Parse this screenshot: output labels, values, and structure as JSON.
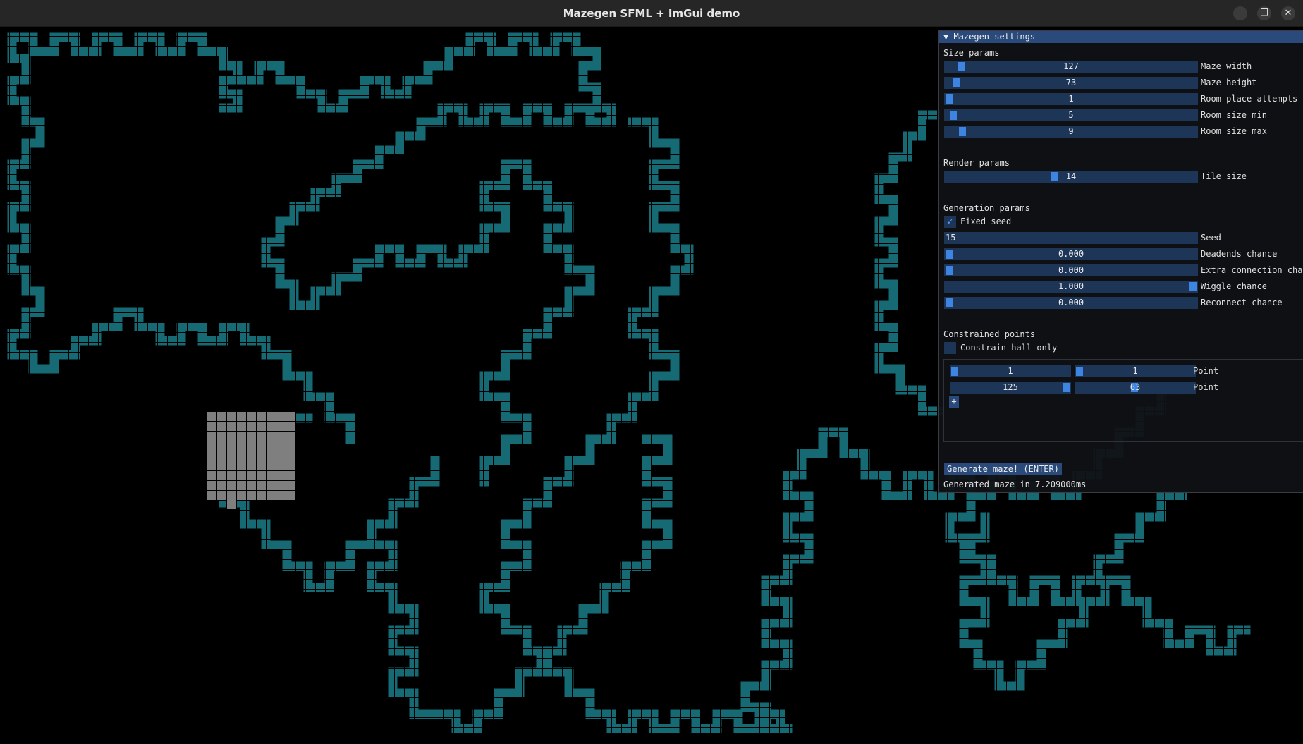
{
  "window": {
    "title": "Mazegen SFML + ImGui demo",
    "minimize_glyph": "–",
    "maximize_glyph": "❐",
    "close_glyph": "✕"
  },
  "colors": {
    "wall": "#166a73",
    "room": "#7f7f7f",
    "background": "#000000"
  },
  "panel": {
    "title": "▼ Mazegen settings",
    "size_section": "Size params",
    "size_params": [
      {
        "label": "Maze width",
        "value": "127"
      },
      {
        "label": "Maze height",
        "value": "73"
      },
      {
        "label": "Room place attempts",
        "value": "1"
      },
      {
        "label": "Room size min",
        "value": "5"
      },
      {
        "label": "Room size max",
        "value": "9"
      }
    ],
    "render_section": "Render params",
    "tile_size": {
      "label": "Tile size",
      "value": "14"
    },
    "generation_section": "Generation params",
    "fixed_seed": {
      "label": "Fixed seed",
      "checked": true,
      "mark": "✓"
    },
    "seed": {
      "label": "Seed",
      "value": "15"
    },
    "chances": [
      {
        "label": "Deadends chance",
        "value": "0.000"
      },
      {
        "label": "Extra connection chance",
        "value": "0.000"
      },
      {
        "label": "Wiggle chance",
        "value": "1.000"
      },
      {
        "label": "Reconnect chance",
        "value": "0.000"
      }
    ],
    "constrained_section": "Constrained points",
    "constrain_hall_only": {
      "label": "Constrain hall only",
      "checked": false
    },
    "points": [
      {
        "x": "1",
        "y": "1",
        "label": "Point"
      },
      {
        "x": "125",
        "y": "63",
        "label": "Point"
      }
    ],
    "add_point_label": "+",
    "generate_button": "Generate maze! (ENTER)",
    "status": "Generated maze in 7.209000ms"
  }
}
